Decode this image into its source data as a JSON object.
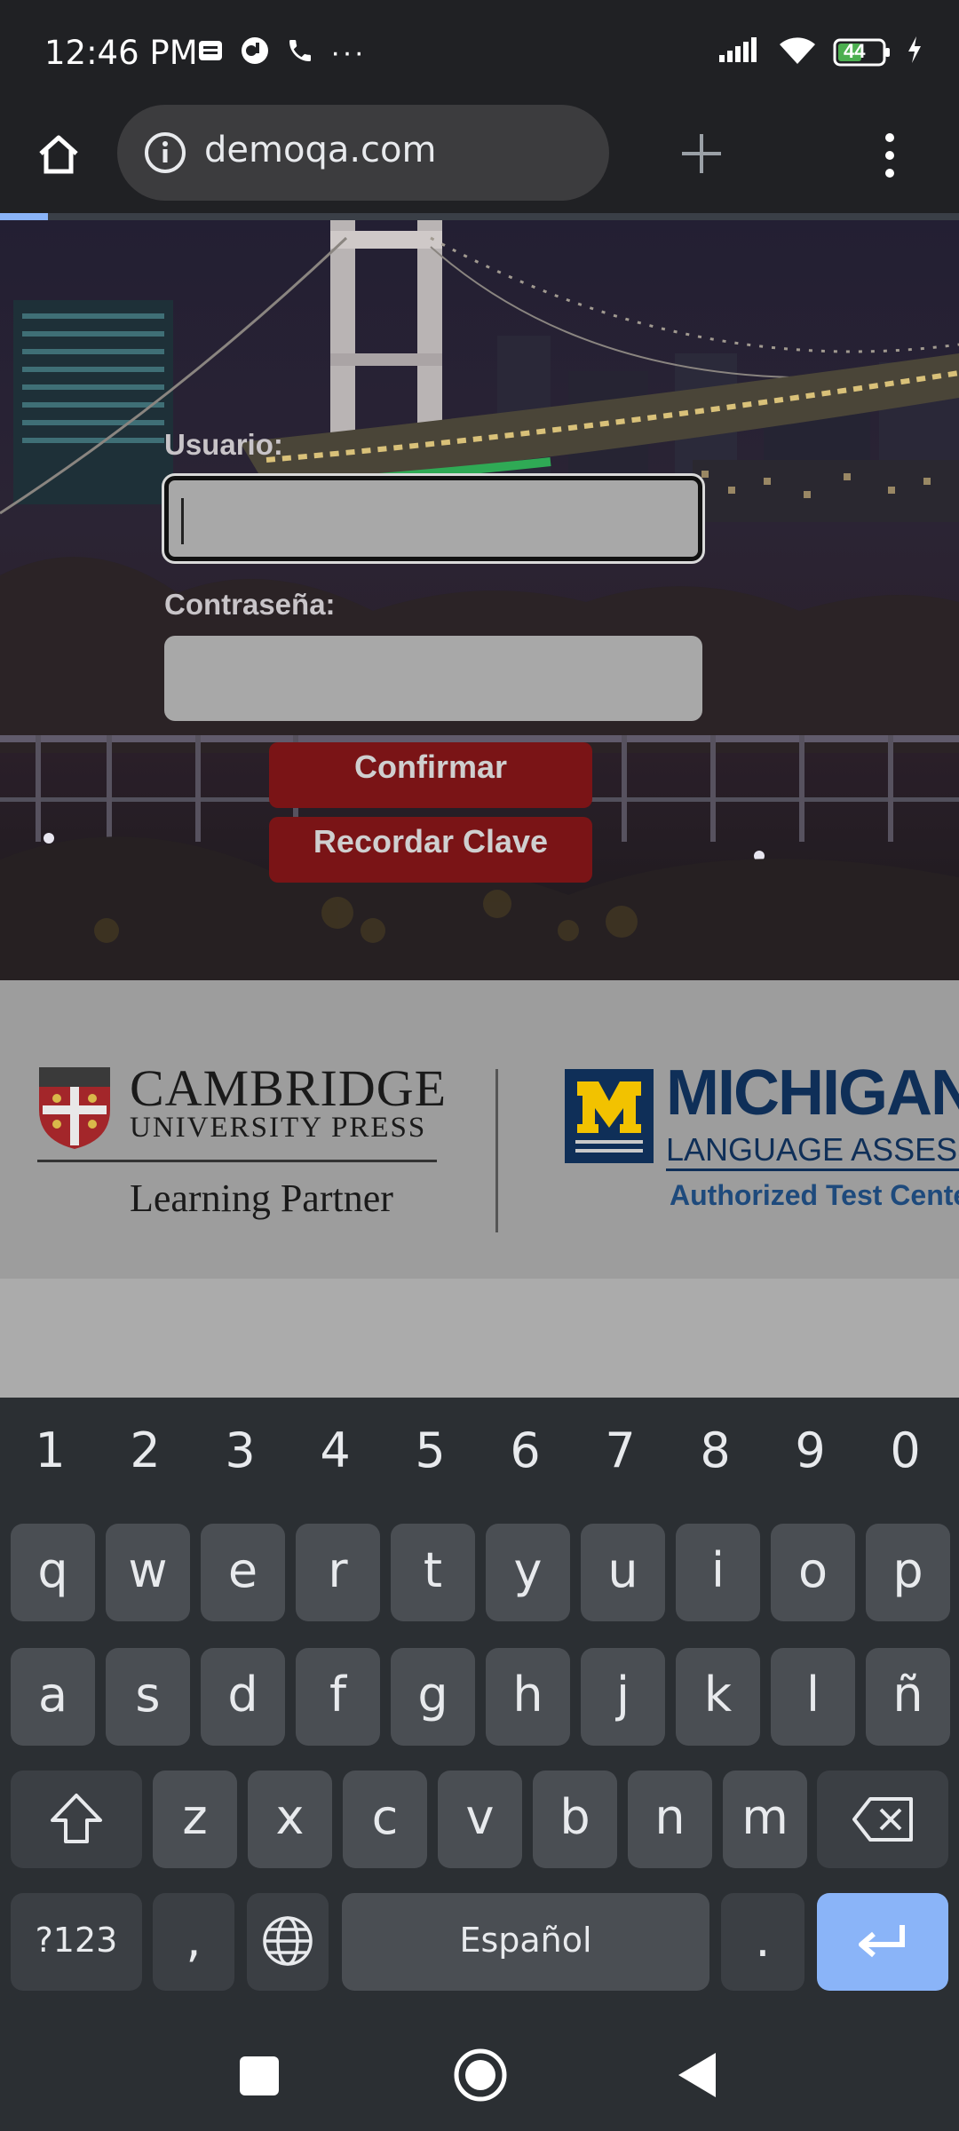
{
  "status_bar": {
    "time": "12:46 PM",
    "more": "···",
    "battery": "44"
  },
  "browser": {
    "url": "demoqa.com",
    "progress_fraction": 0.05
  },
  "login": {
    "username_label": "Usuario:",
    "username_value": "",
    "password_label": "Contraseña:",
    "password_value": "",
    "confirm_label": "Confirmar",
    "recover_label": "Recordar Clave"
  },
  "partners": {
    "cambridge_title": "CAMBRIDGE",
    "cambridge_sub": "UNIVERSITY PRESS",
    "cambridge_tagline": "Learning Partner",
    "michigan_title": "MICHIGAN",
    "michigan_sub": "LANGUAGE ASSESSMENT",
    "michigan_auth": "Authorized Test Center"
  },
  "keyboard": {
    "numbers": [
      "1",
      "2",
      "3",
      "4",
      "5",
      "6",
      "7",
      "8",
      "9",
      "0"
    ],
    "row1": [
      "q",
      "w",
      "e",
      "r",
      "t",
      "y",
      "u",
      "i",
      "o",
      "p"
    ],
    "row2": [
      "a",
      "s",
      "d",
      "f",
      "g",
      "h",
      "j",
      "k",
      "l",
      "ñ"
    ],
    "row3": [
      "z",
      "x",
      "c",
      "v",
      "b",
      "n",
      "m"
    ],
    "symbols_label": "?123",
    "comma": ",",
    "space_label": "Español",
    "period": "."
  },
  "colors": {
    "accent": "#8ab4f8",
    "button_red": "#7a1416",
    "michigan_blue": "#0f2f58",
    "michigan_yellow": "#f2c200"
  }
}
